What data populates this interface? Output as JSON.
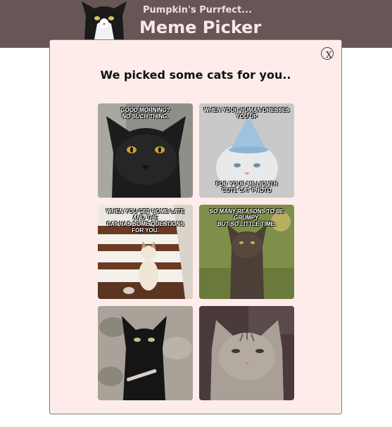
{
  "header": {
    "subtitle": "Pumpkin's Purrfect...",
    "title": "Meme Picker",
    "logo_icon": "tuxedo-cat-logo",
    "background": "#665656"
  },
  "modal": {
    "close_label": "X",
    "heading": "We picked some cats for you..",
    "background": "#fdecea"
  },
  "memes": [
    {
      "top": "GOOD MORNING?\nNO SUCH THING.",
      "bottom": ""
    },
    {
      "top": "WHEN YOUR HUMAN DRESSES\nYOU UP",
      "bottom": "FOR YOUR MILLIONTH\nCUTE CAT PHOTO"
    },
    {
      "top": "WHEN YOU GET HOME LATE AND THE\nCAT HAS SOME QUESTIONS FOR YOU.",
      "bottom": ""
    },
    {
      "top": "SO MANY REASONS TO BE GRUMPY.\nBUT SO LITTLE TIME.",
      "bottom": ""
    },
    {
      "top": "",
      "bottom": ""
    },
    {
      "top": "",
      "bottom": ""
    }
  ]
}
